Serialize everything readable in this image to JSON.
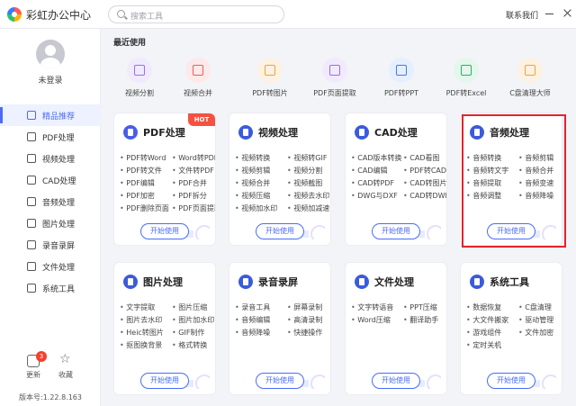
{
  "app": {
    "title": "彩虹办公中心",
    "search_placeholder": "搜索工具",
    "contact": "联系我们"
  },
  "sidebar": {
    "login": "未登录",
    "items": [
      {
        "label": "精品推荐",
        "active": true
      },
      {
        "label": "PDF处理"
      },
      {
        "label": "视频处理"
      },
      {
        "label": "CAD处理"
      },
      {
        "label": "音频处理"
      },
      {
        "label": "图片处理"
      },
      {
        "label": "录音录屏"
      },
      {
        "label": "文件处理"
      },
      {
        "label": "系统工具"
      }
    ],
    "update_label": "更新",
    "update_badge": "3",
    "favorite_label": "收藏",
    "version": "版本号:1.22.8.163"
  },
  "recent": {
    "title": "最近使用",
    "items": [
      {
        "label": "视频分割",
        "color": "#9b6cf0",
        "bg": "#f1eafd"
      },
      {
        "label": "视频合并",
        "color": "#f25a5a",
        "bg": "#fde9e9"
      },
      {
        "label": "PDF转图片",
        "color": "#f0a33a",
        "bg": "#fdf1e1"
      },
      {
        "label": "PDF页面提取",
        "color": "#9b6cf0",
        "bg": "#f1eafd"
      },
      {
        "label": "PDF转PPT",
        "color": "#3f7cf0",
        "bg": "#e6efff"
      },
      {
        "label": "PDF转Excel",
        "color": "#22b46c",
        "bg": "#e4f7ec"
      },
      {
        "label": "C盘清理大师",
        "color": "#f0a33a",
        "bg": "#fdf1e1"
      }
    ]
  },
  "cards": [
    {
      "title": "PDF处理",
      "color": "#4a5de8",
      "hot": "HOT",
      "items": [
        "PDF转Word",
        "Word转PDF",
        "PDF转文件",
        "文件转PDF",
        "PDF编辑",
        "PDF合并",
        "PDF加密",
        "PDF拆分",
        "PDF删除页面",
        "PDF页面提取"
      ]
    },
    {
      "title": "视频处理",
      "color": "#3b5bdb",
      "items": [
        "视频转换",
        "视频转GIF",
        "视频剪辑",
        "视频分割",
        "视频合并",
        "视频截图",
        "视频压缩",
        "视频去水印",
        "视频加水印",
        "视频加减速"
      ]
    },
    {
      "title": "CAD处理",
      "color": "#3b5bdb",
      "items": [
        "CAD版本转换",
        "CAD看图",
        "CAD编辑",
        "PDF转CAD",
        "CAD转PDF",
        "CAD转图片",
        "DWG与DXF",
        "CAD转DWF"
      ]
    },
    {
      "title": "音频处理",
      "color": "#3b5bdb",
      "items": [
        "音频转换",
        "音频剪辑",
        "音频转文字",
        "音频合并",
        "音频提取",
        "音频变速",
        "音频调整",
        "音频降噪"
      ]
    },
    {
      "title": "图片处理",
      "color": "#3b5bdb",
      "items": [
        "文字提取",
        "图片压缩",
        "图片去水印",
        "图片加水印",
        "Heic转图片",
        "GIF制作",
        "抠图换背景",
        "格式转换"
      ]
    },
    {
      "title": "录音录屏",
      "color": "#3b5bdb",
      "items": [
        "录音工具",
        "屏幕录制",
        "音频编辑",
        "高清录制",
        "音频降噪",
        "快捷操作"
      ]
    },
    {
      "title": "文件处理",
      "color": "#3b5bdb",
      "items": [
        "文字转语音",
        "PPT压缩",
        "Word压缩",
        "翻译助手"
      ]
    },
    {
      "title": "系统工具",
      "color": "#3b5bdb",
      "items": [
        "数据恢复",
        "C盘清理",
        "大文件搬家",
        "驱动管理",
        "游戏组件",
        "文件加密",
        "定时关机"
      ]
    }
  ],
  "start_label": "开始使用"
}
